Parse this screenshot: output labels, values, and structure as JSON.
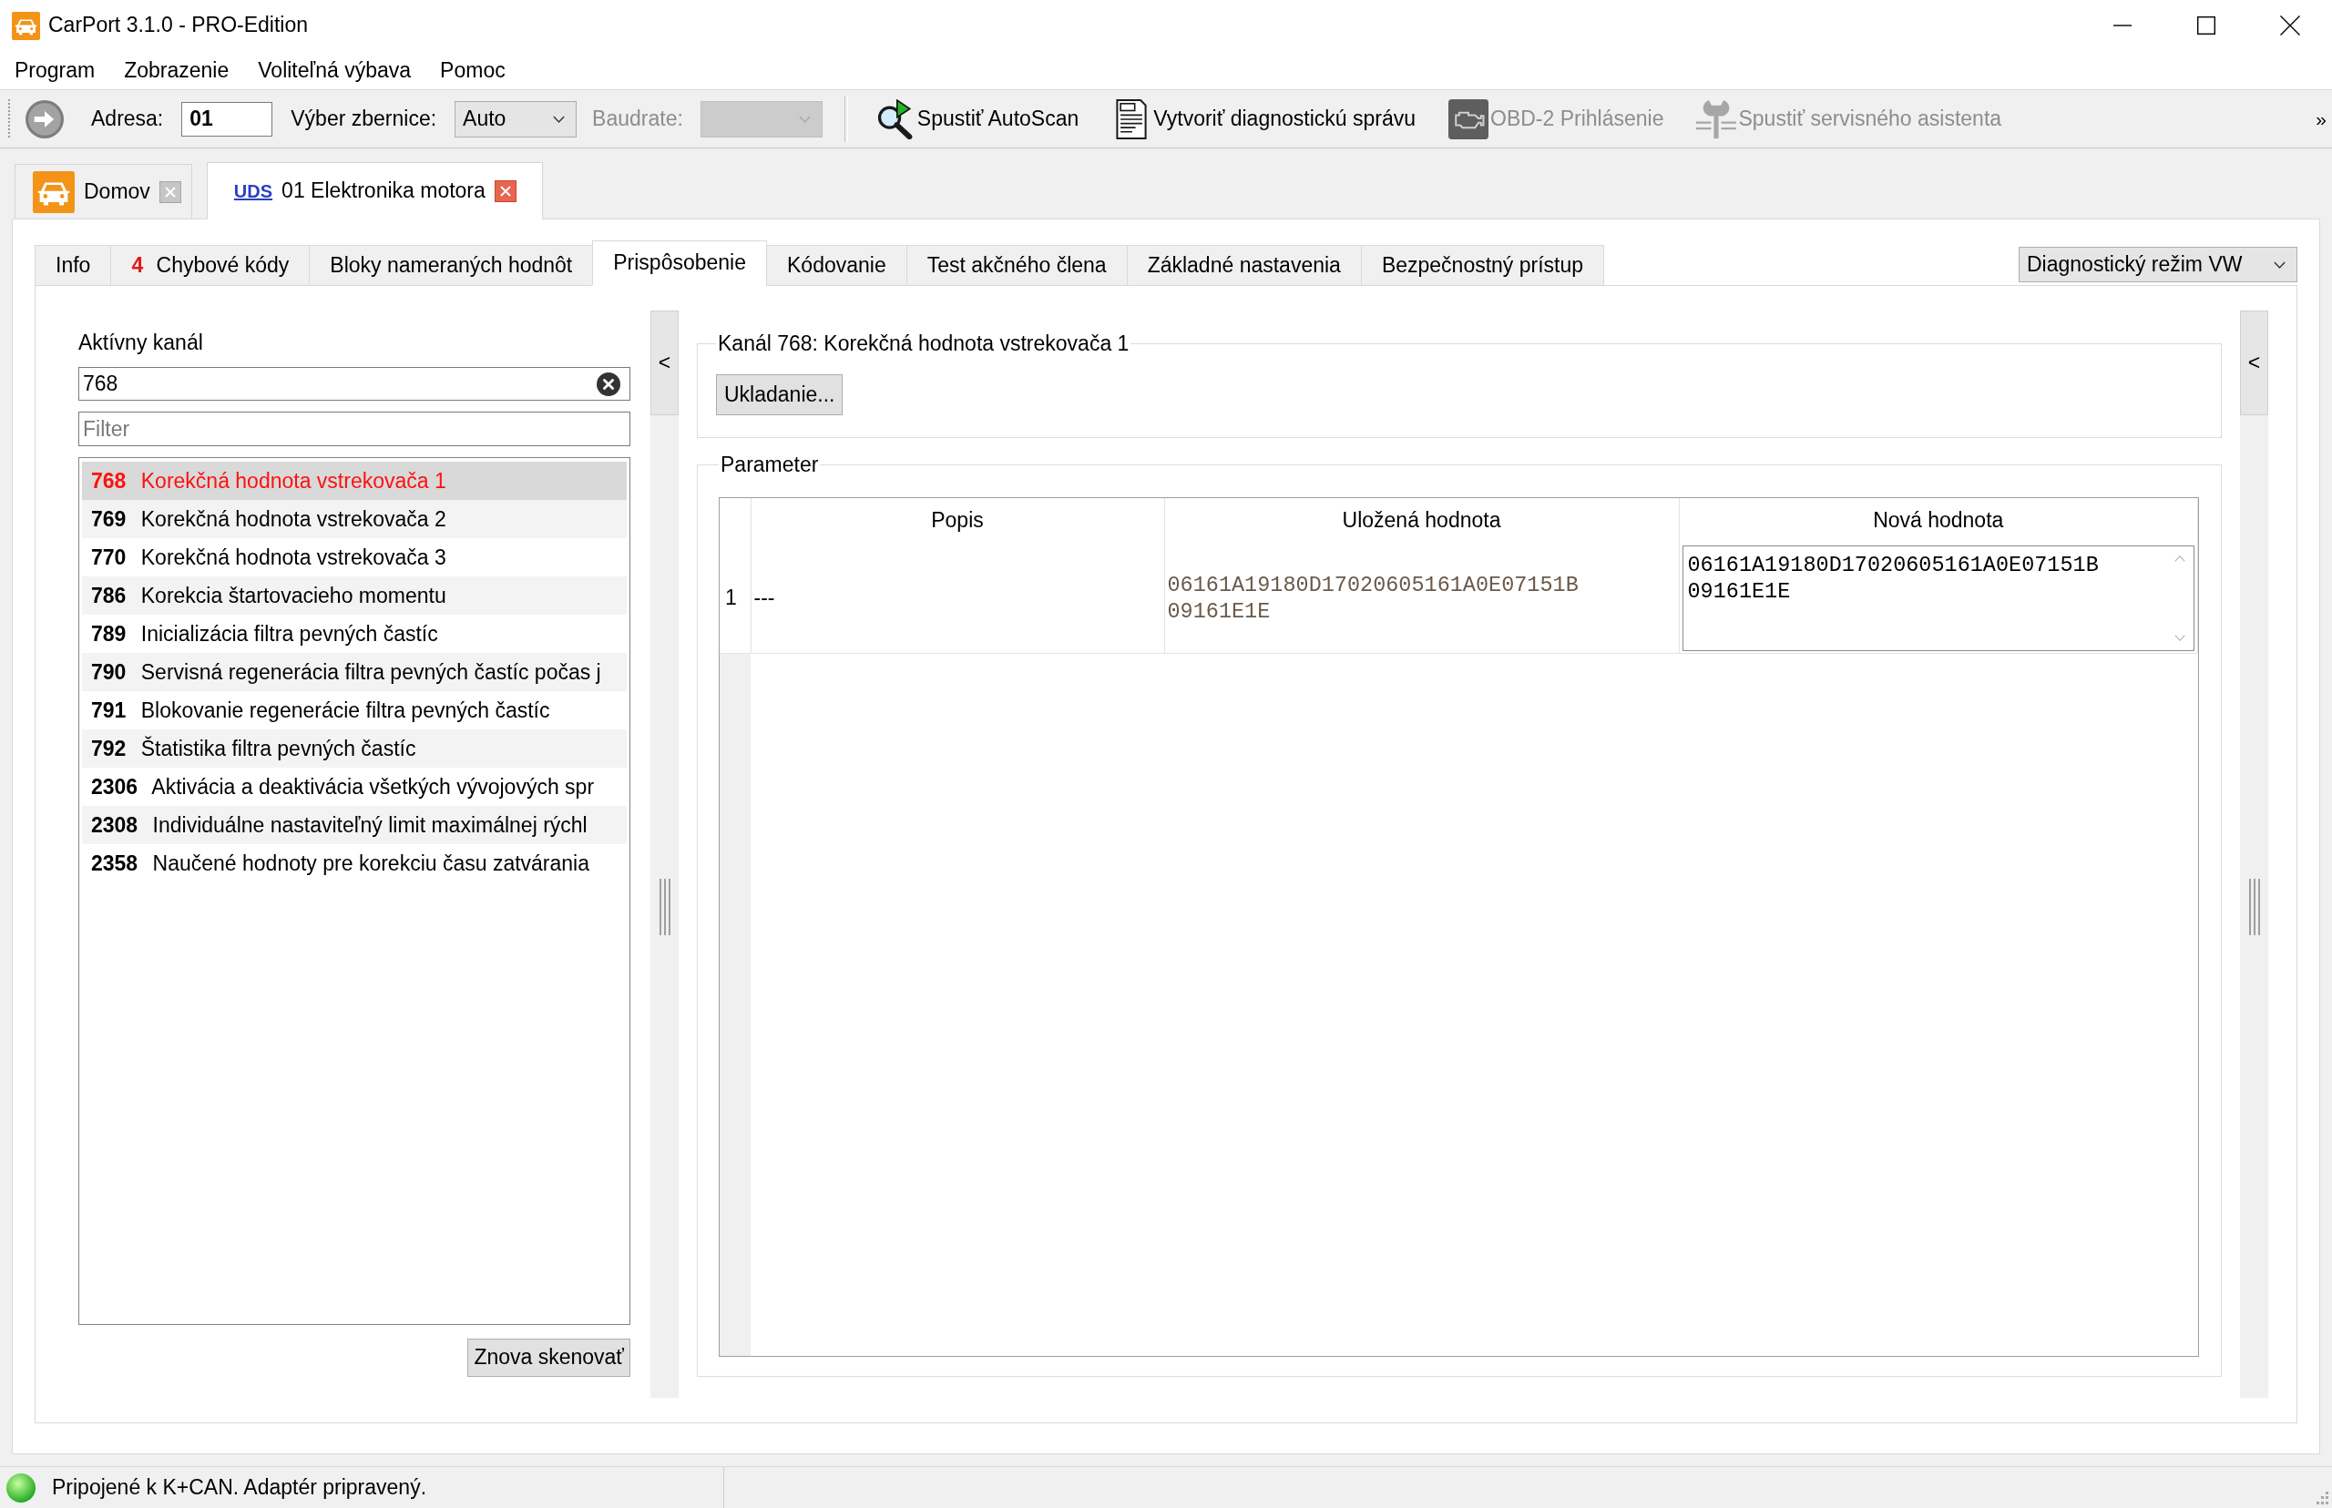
{
  "window": {
    "title": "CarPort 3.1.0 - PRO-Edition"
  },
  "menu": [
    {
      "label": "Program"
    },
    {
      "label": "Zobrazenie"
    },
    {
      "label": "Voliteľná výbava"
    },
    {
      "label": "Pomoc"
    }
  ],
  "toolbar": {
    "address": {
      "label": "Adresa:",
      "value": "01"
    },
    "bus": {
      "label": "Výber zbernice:",
      "value": "Auto"
    },
    "baudrate": {
      "label": "Baudrate:",
      "disabled": true
    },
    "actions": [
      {
        "kind": "autoscan",
        "label": "Spustiť AutoScan",
        "disabled": false
      },
      {
        "kind": "report",
        "label": "Vytvoriť diagnostickú správu",
        "disabled": false
      },
      {
        "kind": "engine",
        "label": "OBD-2 Prihlásenie",
        "disabled": true
      },
      {
        "kind": "service",
        "label": "Spustiť servisného asistenta",
        "disabled": true
      }
    ],
    "overflow": "»"
  },
  "document_tabs": [
    {
      "kind": "home",
      "label": "Domov",
      "selected": false
    },
    {
      "kind": "module",
      "badge": "UDS",
      "label": "01 Elektronika motora",
      "selected": true
    }
  ],
  "tabs": [
    {
      "label": "Info",
      "selected": false
    },
    {
      "count": "4",
      "label": "Chybové kódy",
      "selected": false
    },
    {
      "label": "Bloky nameraných hodnôt",
      "selected": false
    },
    {
      "label": "Prispôsobenie",
      "selected": true
    },
    {
      "label": "Kódovanie",
      "selected": false
    },
    {
      "label": "Test akčného člena",
      "selected": false
    },
    {
      "label": "Základné nastavenia",
      "selected": false
    },
    {
      "label": "Bezpečnostný prístup",
      "selected": false
    }
  ],
  "mode_select": {
    "value": "Diagnostický režim VW"
  },
  "channel_panel": {
    "label": "Aktívny kanál",
    "channel": "768",
    "filter": {
      "placeholder": "Filter"
    },
    "channels": [
      {
        "number": "768",
        "name": "Korekčná hodnota vstrekovača 1",
        "selected": true
      },
      {
        "number": "769",
        "name": "Korekčná hodnota vstrekovača 2",
        "selected": false
      },
      {
        "number": "770",
        "name": "Korekčná hodnota vstrekovača 3",
        "selected": false
      },
      {
        "number": "786",
        "name": "Korekcia štartovacieho momentu",
        "selected": false
      },
      {
        "number": "789",
        "name": "Inicializácia filtra pevných častíc",
        "selected": false
      },
      {
        "number": "790",
        "name": "Servisná regenerácia filtra pevných častíc počas j",
        "selected": false
      },
      {
        "number": "791",
        "name": "Blokovanie regenerácie filtra pevných častíc",
        "selected": false
      },
      {
        "number": "792",
        "name": "Štatistika filtra pevných častíc",
        "selected": false
      },
      {
        "number": "2306",
        "name": "Aktivácia a deaktivácia všetkých vývojových spr",
        "selected": false
      },
      {
        "number": "2308",
        "name": "Individuálne nastaviteľný limit maximálnej rýchl",
        "selected": false
      },
      {
        "number": "2358",
        "name": "Naučené hodnoty pre korekciu času zatvárania",
        "selected": false
      }
    ],
    "rescan_button": "Znova skenovať"
  },
  "left_splitter": {
    "button": "<"
  },
  "channel_group": {
    "title": "Kanál 768: Korekčná hodnota vstrekovača 1",
    "save_button": "Ukladanie..."
  },
  "parameter_group": {
    "title": "Parameter",
    "table": {
      "columns": [
        "Popis",
        "Uložená hodnota",
        "Nová hodnota"
      ],
      "rows": [
        {
          "number": "1",
          "description": "---",
          "stored_value": "06161A19180D17020605161A0E07151B09161E1E",
          "new_value": "06161A19180D17020605161A0E07151B09161E1E"
        }
      ]
    }
  },
  "right_splitter": {
    "button": "<"
  },
  "status_bar": {
    "connected": true,
    "text": "Pripojené k K+CAN. Adaptér pripravený."
  }
}
